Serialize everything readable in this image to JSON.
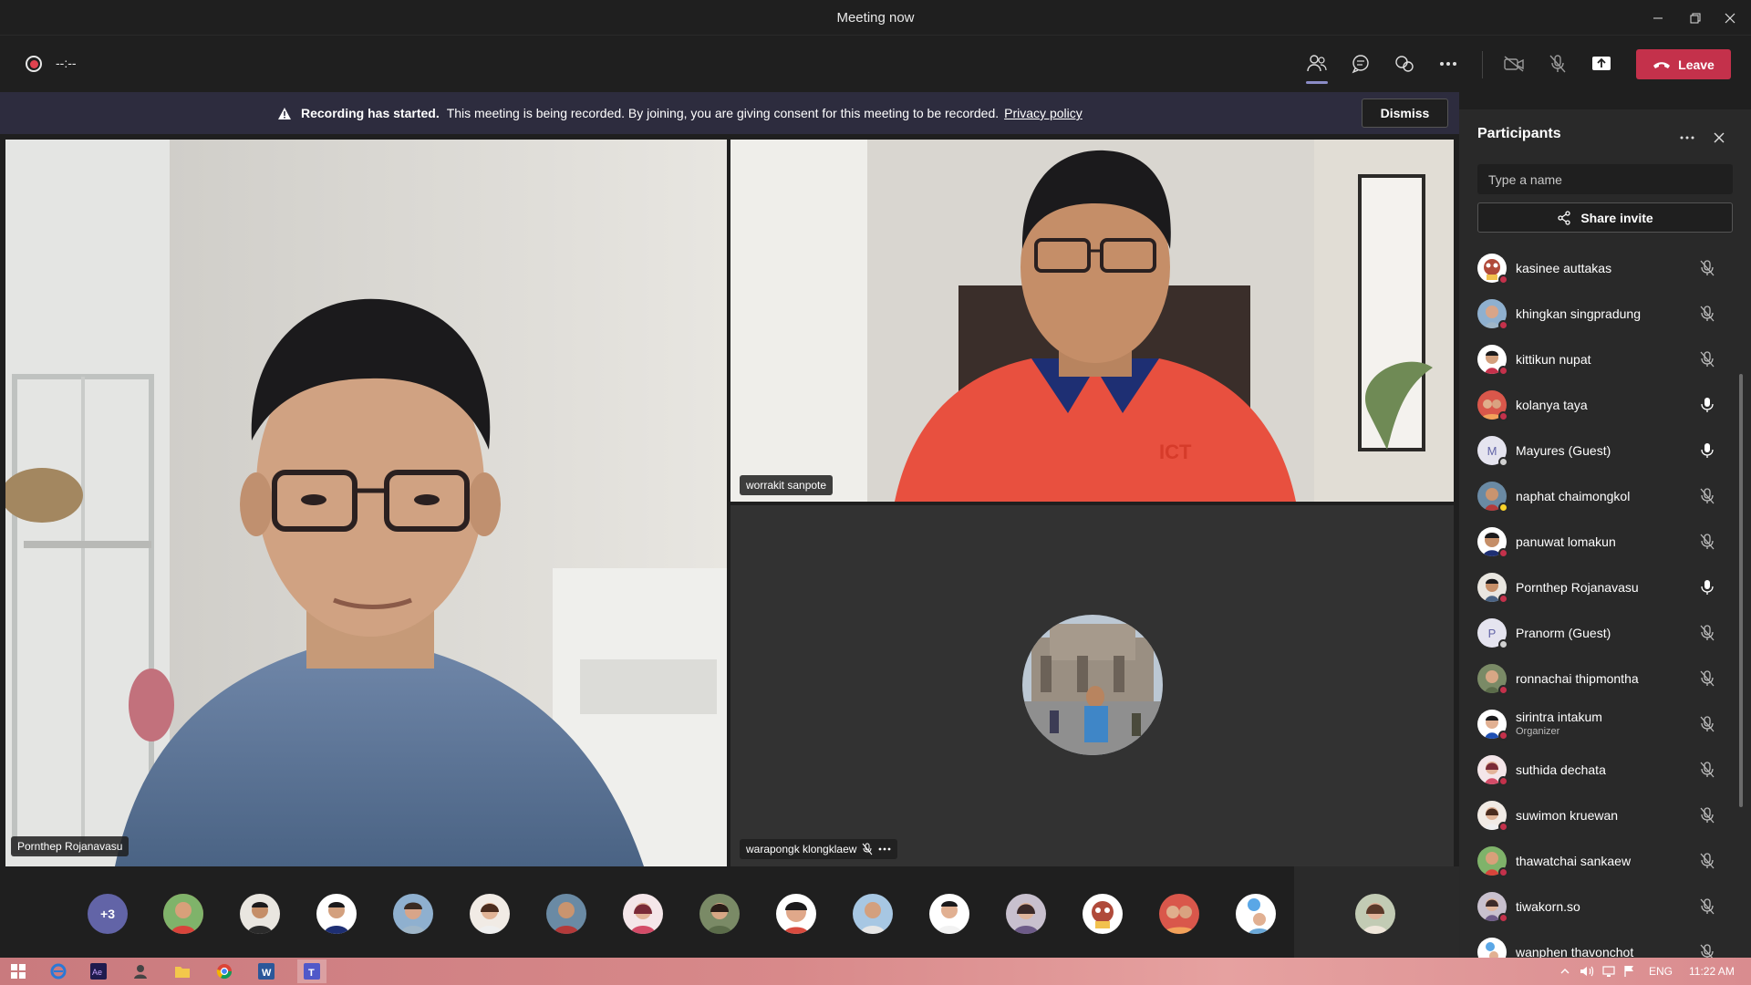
{
  "window": {
    "title": "Meeting now"
  },
  "toolbar": {
    "timer": "--:--",
    "leave_label": "Leave",
    "icons": [
      "participants-icon",
      "chat-icon",
      "reactions-icon",
      "more-icon",
      "camera-off-icon",
      "mic-off-icon",
      "share-screen-icon"
    ]
  },
  "banner": {
    "strong": "Recording has started.",
    "message": "This meeting is being recorded. By joining, you are giving consent for this meeting to be recorded.",
    "link": "Privacy policy",
    "dismiss_label": "Dismiss"
  },
  "videos": {
    "main_name": "Pornthep Rojanavasu",
    "top_right_name": "worrakit sanpote",
    "bottom_right_name": "warapongk klongklaew"
  },
  "strip": {
    "overflow_label": "+3"
  },
  "panel": {
    "title": "Participants",
    "search_placeholder": "Type a name",
    "share_label": "Share invite",
    "participants": [
      {
        "name": "kasinee auttakas",
        "mic": "off"
      },
      {
        "name": "khingkan singpradung",
        "mic": "off"
      },
      {
        "name": "kittikun nupat",
        "mic": "off"
      },
      {
        "name": "kolanya taya",
        "mic": "on"
      },
      {
        "name": "Mayures (Guest)",
        "initial": "M",
        "mic": "on"
      },
      {
        "name": "naphat chaimongkol",
        "mic": "off"
      },
      {
        "name": "panuwat lomakun",
        "mic": "off"
      },
      {
        "name": "Pornthep Rojanavasu",
        "mic": "on"
      },
      {
        "name": "Pranorm (Guest)",
        "initial": "P",
        "mic": "off"
      },
      {
        "name": "ronnachai thipmontha",
        "mic": "off"
      },
      {
        "name": "sirintra intakum",
        "role": "Organizer",
        "mic": "off"
      },
      {
        "name": "suthida dechata",
        "mic": "off"
      },
      {
        "name": "suwimon kruewan",
        "mic": "off"
      },
      {
        "name": "thawatchai sankaew",
        "mic": "off"
      },
      {
        "name": "tiwakorn.so",
        "mic": "off"
      },
      {
        "name": "wanphen thavonchot",
        "mic": "off"
      }
    ]
  },
  "taskbar": {
    "lang": "ENG",
    "time": "11:22 AM"
  }
}
